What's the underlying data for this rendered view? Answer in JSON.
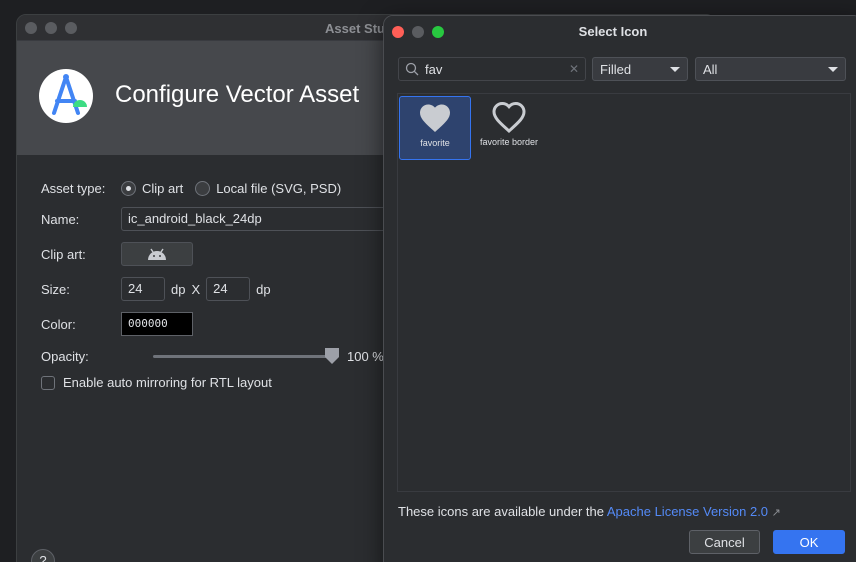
{
  "asset_studio": {
    "window_title": "Asset Studio",
    "header_title": "Configure Vector Asset",
    "asset_type": {
      "label": "Asset type:",
      "options": [
        "Clip art",
        "Local file (SVG, PSD)"
      ],
      "selected": "Clip art"
    },
    "name": {
      "label": "Name:",
      "value": "ic_android_black_24dp"
    },
    "clip_art": {
      "label": "Clip art:",
      "icon": "android-icon"
    },
    "size": {
      "label": "Size:",
      "width": "24",
      "height": "24",
      "unit": "dp",
      "separator": "X"
    },
    "color": {
      "label": "Color:",
      "value": "000000"
    },
    "opacity": {
      "label": "Opacity:",
      "value_text": "100 %",
      "value": 1.0
    },
    "auto_mirror": {
      "label": "Enable auto mirroring for RTL layout",
      "checked": false
    },
    "help_label": "?"
  },
  "select_icon": {
    "window_title": "Select Icon",
    "search": {
      "value": "fav",
      "placeholder": ""
    },
    "style_dropdown": {
      "selected": "Filled"
    },
    "category_dropdown": {
      "selected": "All"
    },
    "icons": [
      {
        "name": "favorite",
        "icon": "heart-filled-icon",
        "selected": true
      },
      {
        "name": "favorite border",
        "icon": "heart-outline-icon",
        "selected": false
      }
    ],
    "license_text": "These icons are available under the",
    "license_link": "Apache License Version 2.0",
    "cancel_label": "Cancel",
    "ok_label": "OK"
  },
  "colors": {
    "background": "#1e1f22",
    "accent": "#3574f0",
    "link": "#548af7"
  }
}
